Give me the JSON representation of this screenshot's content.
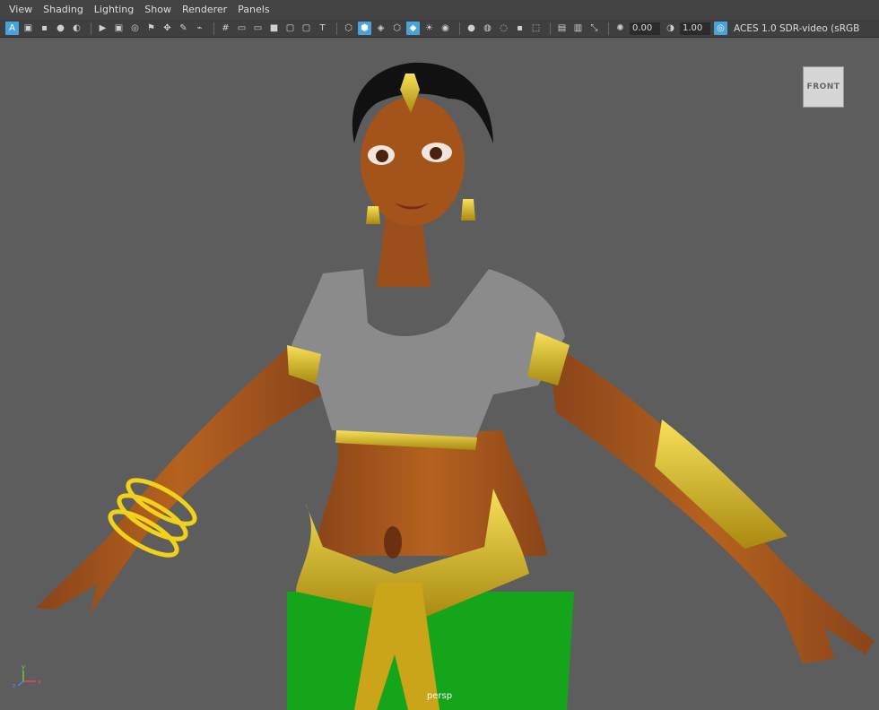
{
  "menu": {
    "items": [
      "View",
      "Shading",
      "Lighting",
      "Show",
      "Renderer",
      "Panels"
    ]
  },
  "toolbar": {
    "exposure": "0.00",
    "gamma": "1.00",
    "color_space": "ACES 1.0 SDR-video (sRGB"
  },
  "viewport": {
    "camera_label": "persp",
    "view_cube_label": "FRONT",
    "axis_labels": {
      "y": "y",
      "x": "x",
      "z": "z"
    }
  }
}
